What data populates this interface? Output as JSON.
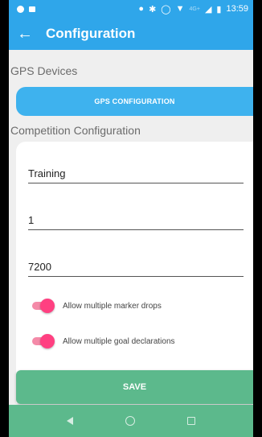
{
  "status_bar": {
    "time": "13:59",
    "network": "4G+",
    "icons": [
      "notification-dot-icon",
      "image-notification-icon",
      "location-icon",
      "bluetooth-icon",
      "alarm-icon",
      "wifi-icon",
      "signal-icon",
      "battery-icon"
    ]
  },
  "app_bar": {
    "title": "Configuration",
    "back_icon": "arrow-left-icon",
    "color": "#2fa6ea"
  },
  "sections": {
    "gps_devices_label": "GPS Devices",
    "gps_button_label": "GPS CONFIGURATION",
    "competition_label": "Competition Configuration"
  },
  "form": {
    "field1_value": "Training",
    "field2_value": "1",
    "field3_value": "7200",
    "toggle1_label": "Allow multiple marker drops",
    "toggle1_on": true,
    "toggle2_label": "Allow multiple goal declarations",
    "toggle2_on": true,
    "accent_color": "#ff4081"
  },
  "save_button_label": "SAVE",
  "nav_bar": {
    "icons": [
      "nav-back-icon",
      "nav-home-icon",
      "nav-recents-icon"
    ],
    "color": "#5cb98c"
  }
}
